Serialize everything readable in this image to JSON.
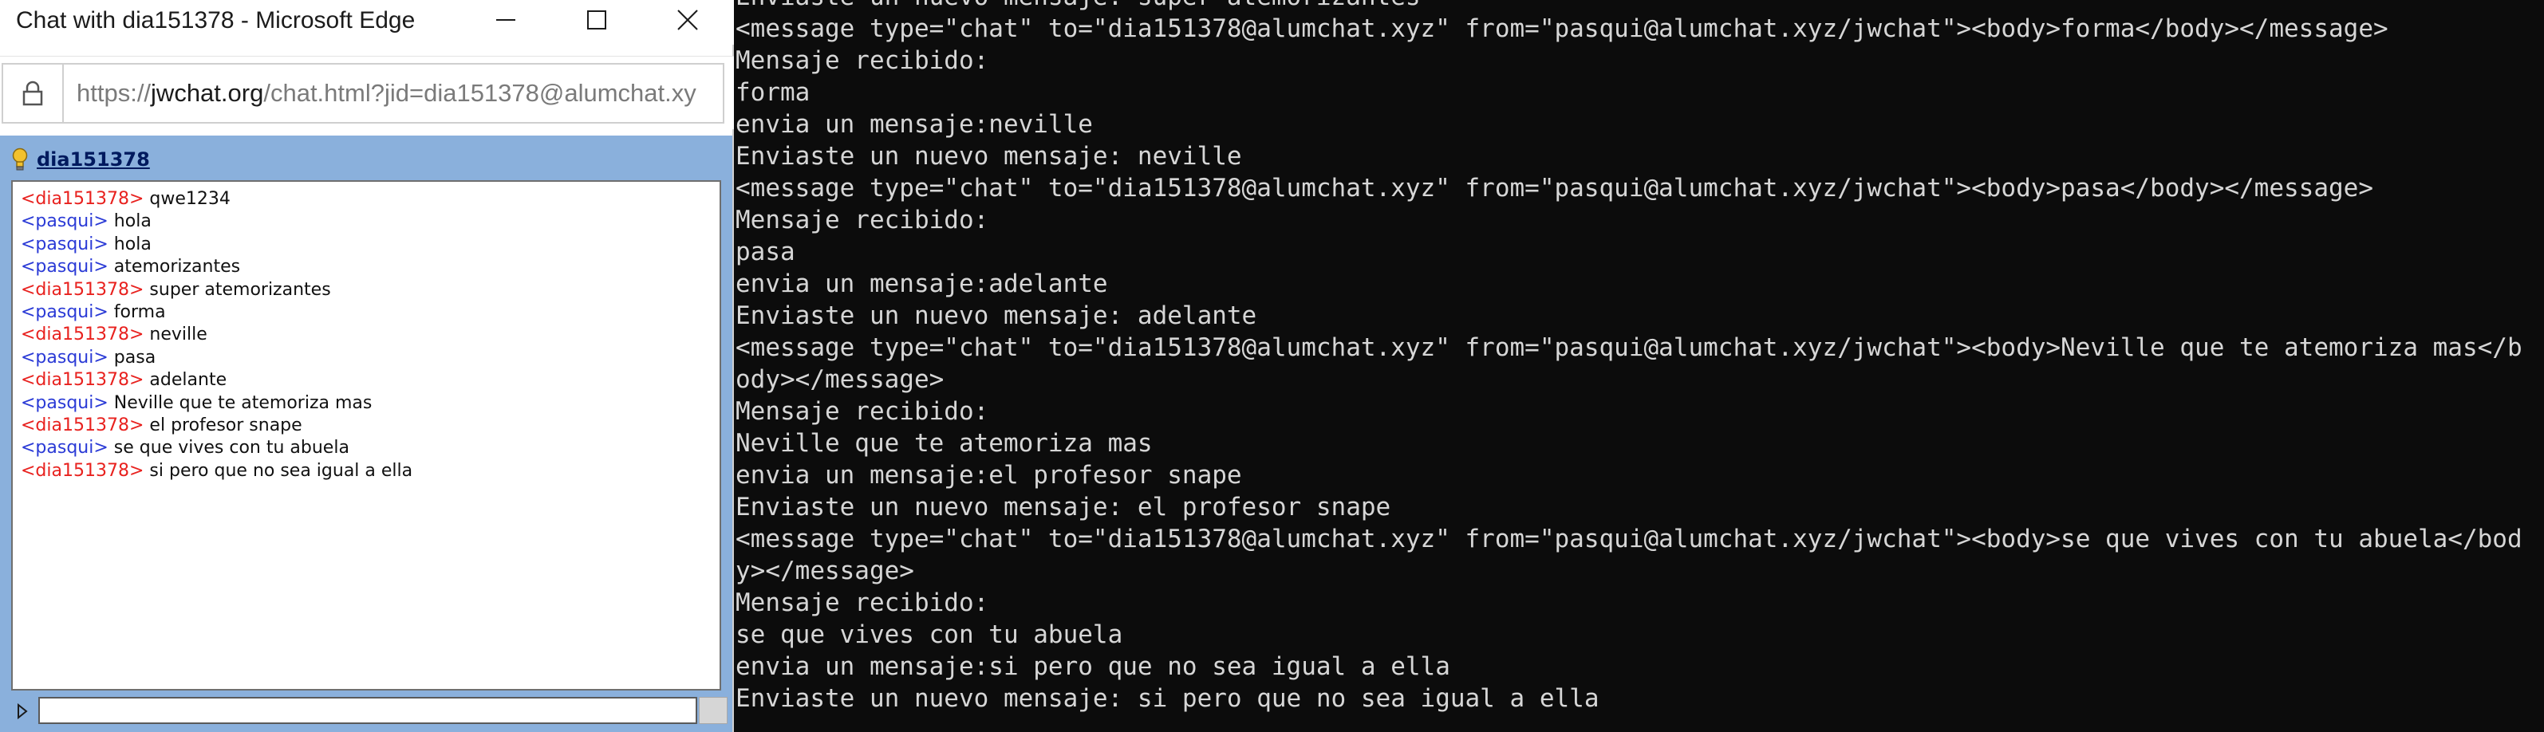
{
  "window": {
    "title": "Chat with dia151378 - Microsoft Edge",
    "url_prefix": "https://",
    "url_domain": "jwchat.org",
    "url_rest": "/chat.html?jid=dia151378@alumchat.xy"
  },
  "chat": {
    "contact": "dia151378",
    "messages": [
      {
        "nick": "<dia151378>",
        "text": "qwe1234",
        "who": "dia"
      },
      {
        "nick": "<pasqui>",
        "text": "hola",
        "who": "pasqui"
      },
      {
        "nick": "<pasqui>",
        "text": "hola",
        "who": "pasqui"
      },
      {
        "nick": "<pasqui>",
        "text": "atemorizantes",
        "who": "pasqui"
      },
      {
        "nick": "<dia151378>",
        "text": "super atemorizantes",
        "who": "dia"
      },
      {
        "nick": "<pasqui>",
        "text": "forma",
        "who": "pasqui"
      },
      {
        "nick": "<dia151378>",
        "text": "neville",
        "who": "dia"
      },
      {
        "nick": "<pasqui>",
        "text": "pasa",
        "who": "pasqui"
      },
      {
        "nick": "<dia151378>",
        "text": "adelante",
        "who": "dia"
      },
      {
        "nick": "<pasqui>",
        "text": "Neville que te atemoriza mas",
        "who": "pasqui"
      },
      {
        "nick": "<dia151378>",
        "text": "el profesor snape",
        "who": "dia"
      },
      {
        "nick": "<pasqui>",
        "text": "se que vives con tu abuela",
        "who": "pasqui"
      },
      {
        "nick": "<dia151378>",
        "text": "si pero que no sea igual a ella",
        "who": "dia"
      }
    ],
    "input_value": ""
  },
  "console": {
    "lines": [
      "Enviaste un nuevo mensaje: super atemorizantes",
      "<message type=\"chat\" to=\"dia151378@alumchat.xyz\" from=\"pasqui@alumchat.xyz/jwchat\"><body>forma</body></message>",
      "Mensaje recibido:",
      "forma",
      "envia un mensaje:neville",
      "Enviaste un nuevo mensaje: neville",
      "<message type=\"chat\" to=\"dia151378@alumchat.xyz\" from=\"pasqui@alumchat.xyz/jwchat\"><body>pasa</body></message>",
      "Mensaje recibido:",
      "pasa",
      "envia un mensaje:adelante",
      "Enviaste un nuevo mensaje: adelante",
      "<message type=\"chat\" to=\"dia151378@alumchat.xyz\" from=\"pasqui@alumchat.xyz/jwchat\"><body>Neville que te atemoriza mas</b",
      "ody></message>",
      "Mensaje recibido:",
      "Neville que te atemoriza mas",
      "envia un mensaje:el profesor snape",
      "Enviaste un nuevo mensaje: el profesor snape",
      "<message type=\"chat\" to=\"dia151378@alumchat.xyz\" from=\"pasqui@alumchat.xyz/jwchat\"><body>se que vives con tu abuela</bod",
      "y></message>",
      "Mensaje recibido:",
      "se que vives con tu abuela",
      "envia un mensaje:si pero que no sea igual a ella",
      "Enviaste un nuevo mensaje: si pero que no sea igual a ella"
    ]
  },
  "colors": {
    "dia_nick": "#e8211e",
    "pasqui_nick": "#2a3ad6",
    "chat_background": "#8ab0dc",
    "console_background": "#0c0c0c",
    "console_text": "#d6d6d6"
  },
  "icons": {
    "minimize": "minimize-icon",
    "maximize": "maximize-icon",
    "close": "close-icon",
    "lock": "lock-icon",
    "status": "lightbulb-icon",
    "expand": "triangle-right-icon"
  }
}
